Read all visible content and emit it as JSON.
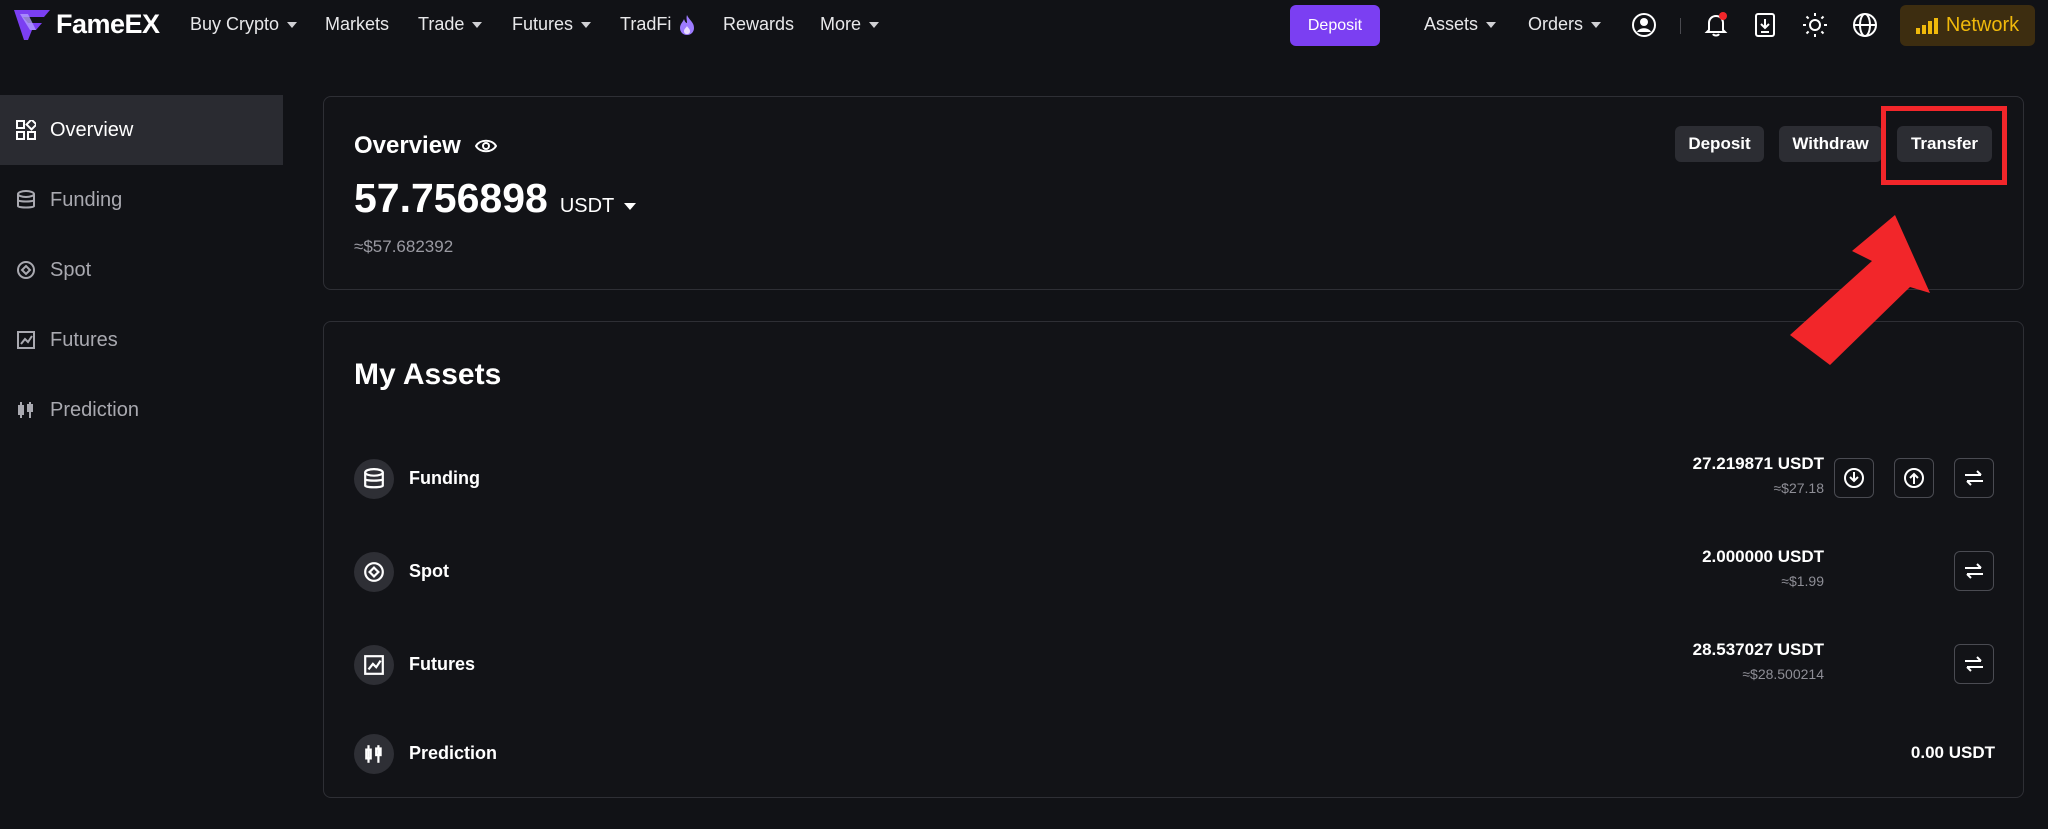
{
  "brand": {
    "name": "FameEX"
  },
  "nav": {
    "buy_crypto": "Buy Crypto",
    "markets": "Markets",
    "trade": "Trade",
    "futures": "Futures",
    "tradfi": "TradFi",
    "rewards": "Rewards",
    "more": "More",
    "deposit": "Deposit",
    "assets": "Assets",
    "orders": "Orders",
    "network": "Network"
  },
  "sidebar": {
    "items": [
      {
        "label": "Overview",
        "icon": "grid-icon"
      },
      {
        "label": "Funding",
        "icon": "database-icon"
      },
      {
        "label": "Spot",
        "icon": "spot-icon"
      },
      {
        "label": "Futures",
        "icon": "chart-icon"
      },
      {
        "label": "Prediction",
        "icon": "candlestick-icon"
      }
    ]
  },
  "overview": {
    "title": "Overview",
    "amount": "57.756898",
    "unit": "USDT",
    "usd_value": "≈$57.682392",
    "buttons": {
      "deposit": "Deposit",
      "withdraw": "Withdraw",
      "transfer": "Transfer"
    }
  },
  "assets": {
    "title": "My Assets",
    "rows": [
      {
        "name": "Funding",
        "amount": "27.219871 USDT",
        "usd": "≈$27.18"
      },
      {
        "name": "Spot",
        "amount": "2.000000 USDT",
        "usd": "≈$1.99"
      },
      {
        "name": "Futures",
        "amount": "28.537027 USDT",
        "usd": "≈$28.500214"
      },
      {
        "name": "Prediction",
        "amount": "0.00 USDT",
        "usd": ""
      }
    ]
  },
  "colors": {
    "background": "#111216",
    "accent": "#7b3ff2",
    "highlight": "#f2262a",
    "network": "#f0b90b"
  }
}
